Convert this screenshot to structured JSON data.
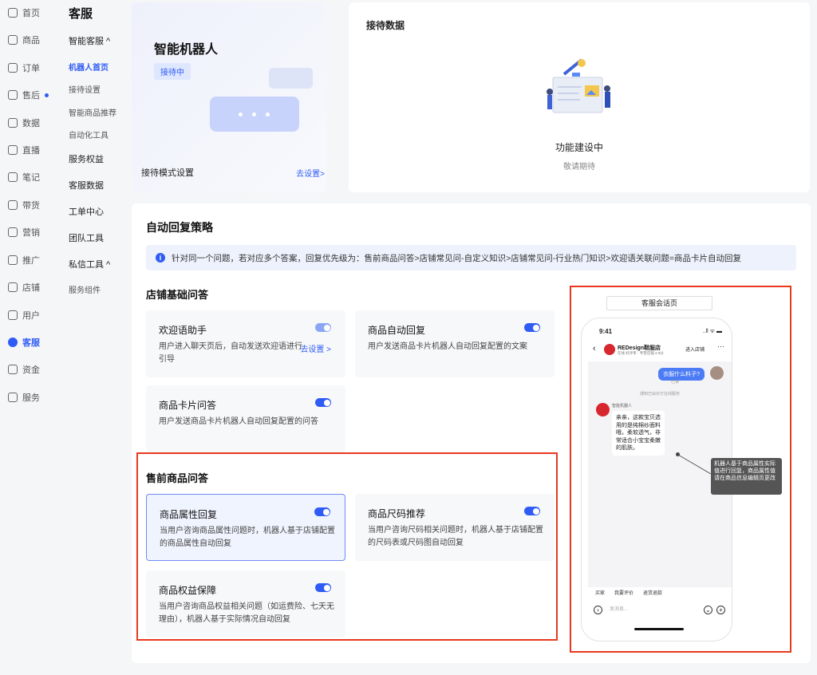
{
  "primary_nav": [
    {
      "label": "首页",
      "icon": "home-icon"
    },
    {
      "label": "商品",
      "icon": "product-icon"
    },
    {
      "label": "订单",
      "icon": "order-icon"
    },
    {
      "label": "售后",
      "icon": "aftersale-icon"
    },
    {
      "label": "数据",
      "icon": "data-icon"
    },
    {
      "label": "直播",
      "icon": "live-icon"
    },
    {
      "label": "笔记",
      "icon": "note-icon"
    },
    {
      "label": "带货",
      "icon": "sell-icon"
    },
    {
      "label": "营销",
      "icon": "marketing-icon"
    },
    {
      "label": "推广",
      "icon": "promote-icon"
    },
    {
      "label": "店铺",
      "icon": "store-icon"
    },
    {
      "label": "用户",
      "icon": "user-icon"
    },
    {
      "label": "客服",
      "icon": "service-icon"
    },
    {
      "label": "资金",
      "icon": "funds-icon"
    },
    {
      "label": "服务",
      "icon": "services-icon"
    }
  ],
  "secondary_nav": {
    "title": "客服",
    "groups": [
      {
        "label": "智能客服 ^"
      },
      {
        "label": "机器人首页"
      },
      {
        "label": "接待设置"
      },
      {
        "label": "智能商品推荐"
      },
      {
        "label": "自动化工具"
      },
      {
        "label": "服务权益"
      },
      {
        "label": "客服数据"
      },
      {
        "label": "工单中心"
      },
      {
        "label": "团队工具"
      },
      {
        "label": "私信工具 ^"
      },
      {
        "label": "服务组件"
      }
    ]
  },
  "robot_card": {
    "title": "智能机器人",
    "status_badge": "接待中",
    "mode_label": "接待模式设置",
    "mode_link": "去设置>"
  },
  "data_card": {
    "title": "接待数据",
    "building_title": "功能建设中",
    "building_sub": "敬请期待"
  },
  "strategy": {
    "title": "自动回复策略",
    "notice": "针对同一个问题，若对应多个答案，回复优先级为：售前商品问答>店铺常见问-自定义知识>店铺常见问-行业热门知识>欢迎语关联问题=商品卡片自动回复",
    "basic_title": "店铺基础问答",
    "basic_items": [
      {
        "title": "欢迎语助手",
        "desc": "用户进入聊天页后，自动发送欢迎语进行引导",
        "link": "去设置 >"
      },
      {
        "title": "商品自动回复",
        "desc": "用户发送商品卡片机器人自动回复配置的文案"
      },
      {
        "title": "商品卡片问答",
        "desc": "用户发送商品卡片机器人自动回复配置的问答"
      }
    ],
    "presale_title": "售前商品问答",
    "presale_items": [
      {
        "title": "商品属性回复",
        "desc": "当用户咨询商品属性问题时，机器人基于店铺配置的商品属性自动回复"
      },
      {
        "title": "商品尺码推荐",
        "desc": "当用户咨询尺码相关问题时，机器人基于店铺配置的尺码表或尺码图自动回复"
      },
      {
        "title": "商品权益保障",
        "desc": "当用户咨询商品权益相关问题（如运费险、七天无理由），机器人基于实际情况自动回复"
      }
    ]
  },
  "preview": {
    "tab": "客服会话页",
    "time": "9:41",
    "signal": "..ll ᯤ ▬",
    "shop_name": "REDesign鞋服店",
    "shop_meta": "在线 好评率 · 专营店铺 4.9分",
    "enter_shop": "进入店铺",
    "question": "衣服什么料子?",
    "read_status": "已读",
    "system_note": "通知已由对方在线服务",
    "bot_name": "智能机器人",
    "answer": "亲亲，这款宝贝选用的是纯棉纱面料哦，柔软透气，非常适合小宝宝柔嫩的肌肤。",
    "tooltip": "机器人基于商品属性实际值进行回复，商品属性值请在商品信息编辑页更改",
    "quick_replies": [
      "买家",
      "我要评价",
      "退货退款"
    ],
    "input_placeholder": "发消息..."
  },
  "colors": {
    "accent": "#2f5cf5",
    "highlight_border": "#e8391f"
  }
}
